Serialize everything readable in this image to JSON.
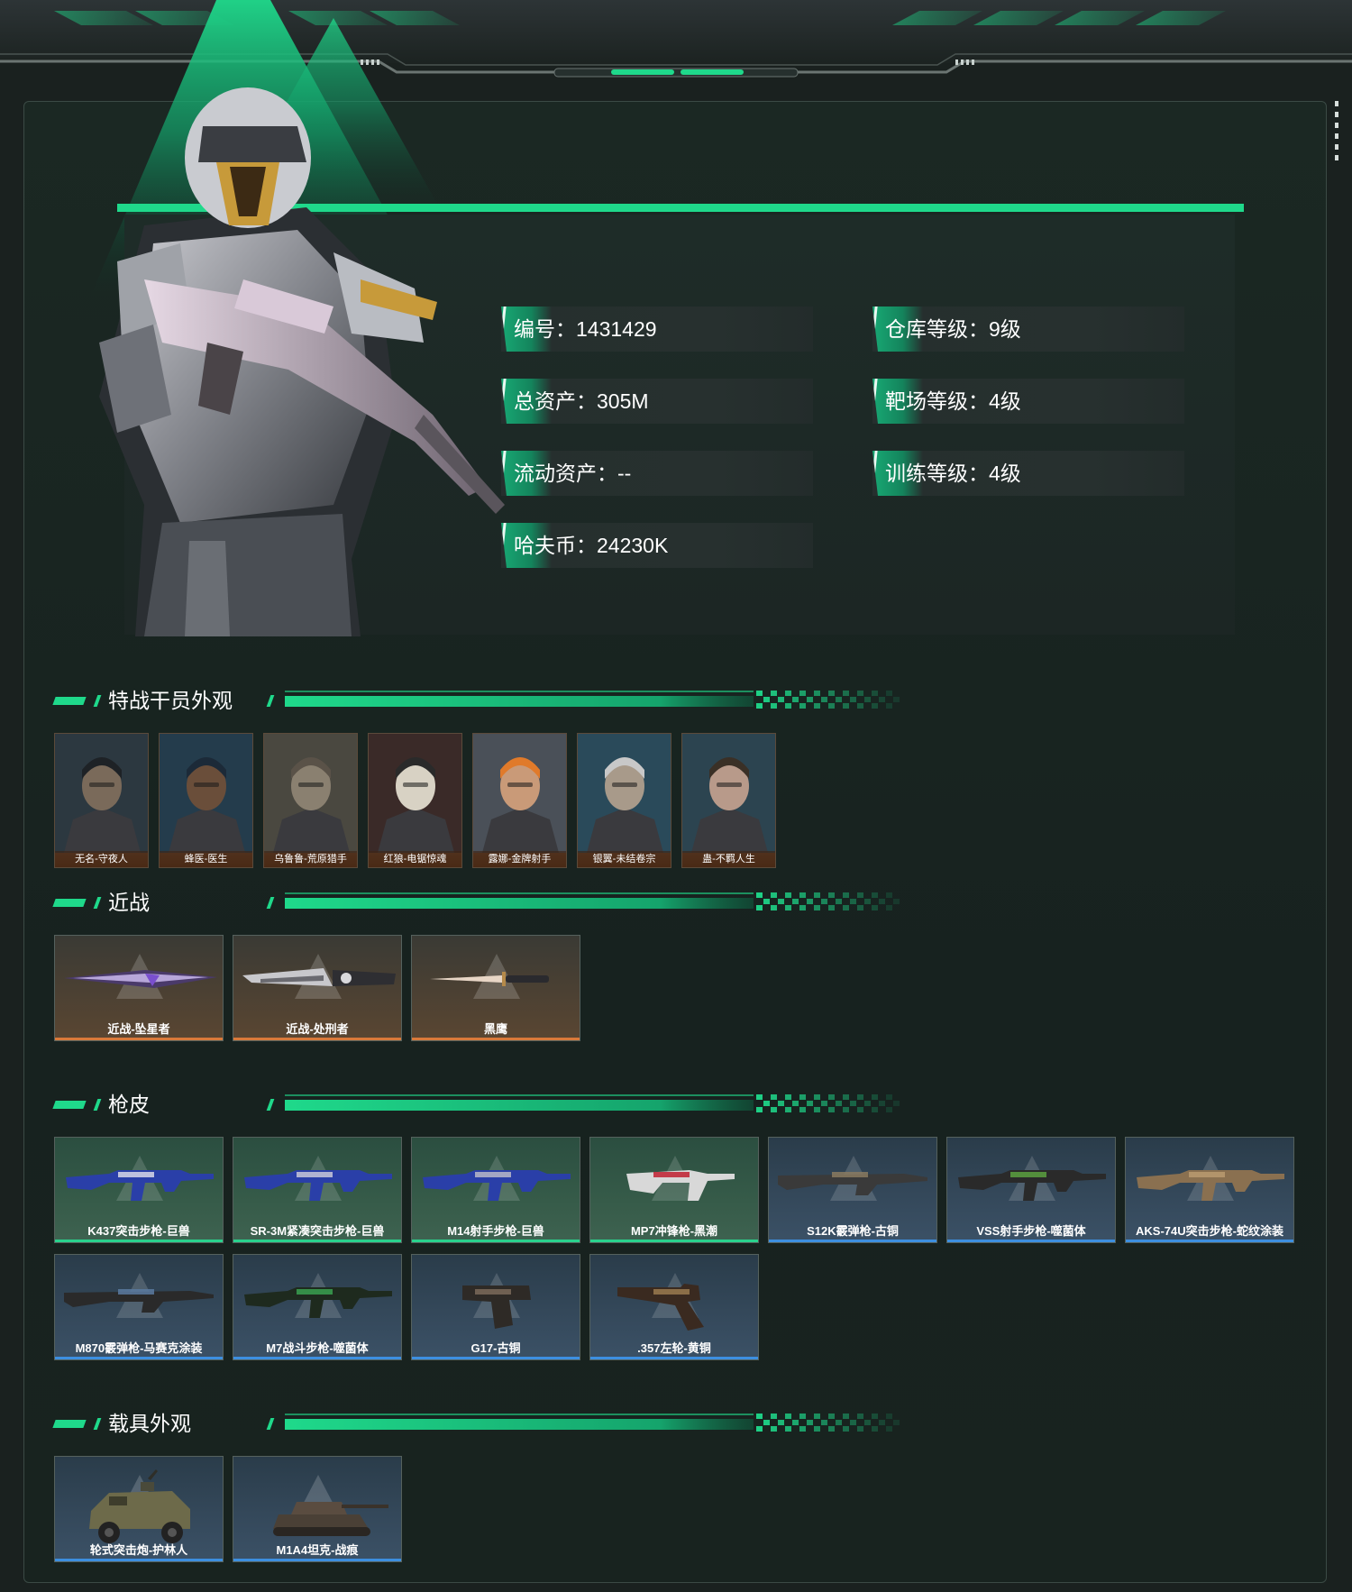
{
  "colors": {
    "accent": "#1fd98b",
    "panel_bg": "#1b2823",
    "melee_bar": "#d9793a",
    "green_bar": "#29d38d",
    "blue_bar": "#3d8fe0"
  },
  "profile": {
    "id": "编号：1431429",
    "total_assets": "总资产：305M",
    "liquid_assets": "流动资产：--",
    "hafu_coin": "哈夫币：24230K",
    "warehouse_level": "仓库等级：9级",
    "range_level": "靶场等级：4级",
    "training_level": "训练等级：4级"
  },
  "sections": {
    "operators": "特战干员外观",
    "melee": "近战",
    "gun_skins": "枪皮",
    "vehicles": "载具外观"
  },
  "operators": [
    {
      "label": "无名-守夜人",
      "icon": "operator-portrait"
    },
    {
      "label": "蜂医-医生",
      "icon": "operator-portrait"
    },
    {
      "label": "乌鲁鲁-荒原猎手",
      "icon": "operator-portrait"
    },
    {
      "label": "红狼-电锯惊魂",
      "icon": "operator-portrait"
    },
    {
      "label": "露娜-金牌射手",
      "icon": "operator-portrait"
    },
    {
      "label": "银翼-未结卷宗",
      "icon": "operator-portrait"
    },
    {
      "label": "蛊-不羁人生",
      "icon": "operator-portrait"
    }
  ],
  "melee": [
    {
      "label": "近战-坠星者",
      "icon": "blade-icon"
    },
    {
      "label": "近战-处刑者",
      "icon": "blade-icon"
    },
    {
      "label": "黑鹰",
      "icon": "knife-icon"
    }
  ],
  "gun_skins": [
    {
      "label": "K437突击步枪-巨兽",
      "rarity": "green",
      "icon": "rifle-icon"
    },
    {
      "label": "SR-3M紧凑突击步枪-巨兽",
      "rarity": "green",
      "icon": "rifle-icon"
    },
    {
      "label": "M14射手步枪-巨兽",
      "rarity": "green",
      "icon": "rifle-icon"
    },
    {
      "label": "MP7冲锋枪-黑潮",
      "rarity": "green",
      "icon": "smg-icon"
    },
    {
      "label": "S12K霰弹枪-古铜",
      "rarity": "blue",
      "icon": "shotgun-icon"
    },
    {
      "label": "VSS射手步枪-噬菌体",
      "rarity": "blue",
      "icon": "rifle-icon"
    },
    {
      "label": "AKS-74U突击步枪-蛇纹涂装",
      "rarity": "blue",
      "icon": "rifle-icon"
    },
    {
      "label": "M870霰弹枪-马赛克涂装",
      "rarity": "blue",
      "icon": "shotgun-icon"
    },
    {
      "label": "M7战斗步枪-噬菌体",
      "rarity": "blue",
      "icon": "rifle-icon"
    },
    {
      "label": "G17-古铜",
      "rarity": "blue",
      "icon": "pistol-icon"
    },
    {
      "label": ".357左轮-黄铜",
      "rarity": "blue",
      "icon": "revolver-icon"
    }
  ],
  "vehicles": [
    {
      "label": "轮式突击炮-护林人",
      "rarity": "blue",
      "icon": "armored-car-icon"
    },
    {
      "label": "M1A4坦克-战痕",
      "rarity": "blue",
      "icon": "tank-icon"
    }
  ]
}
